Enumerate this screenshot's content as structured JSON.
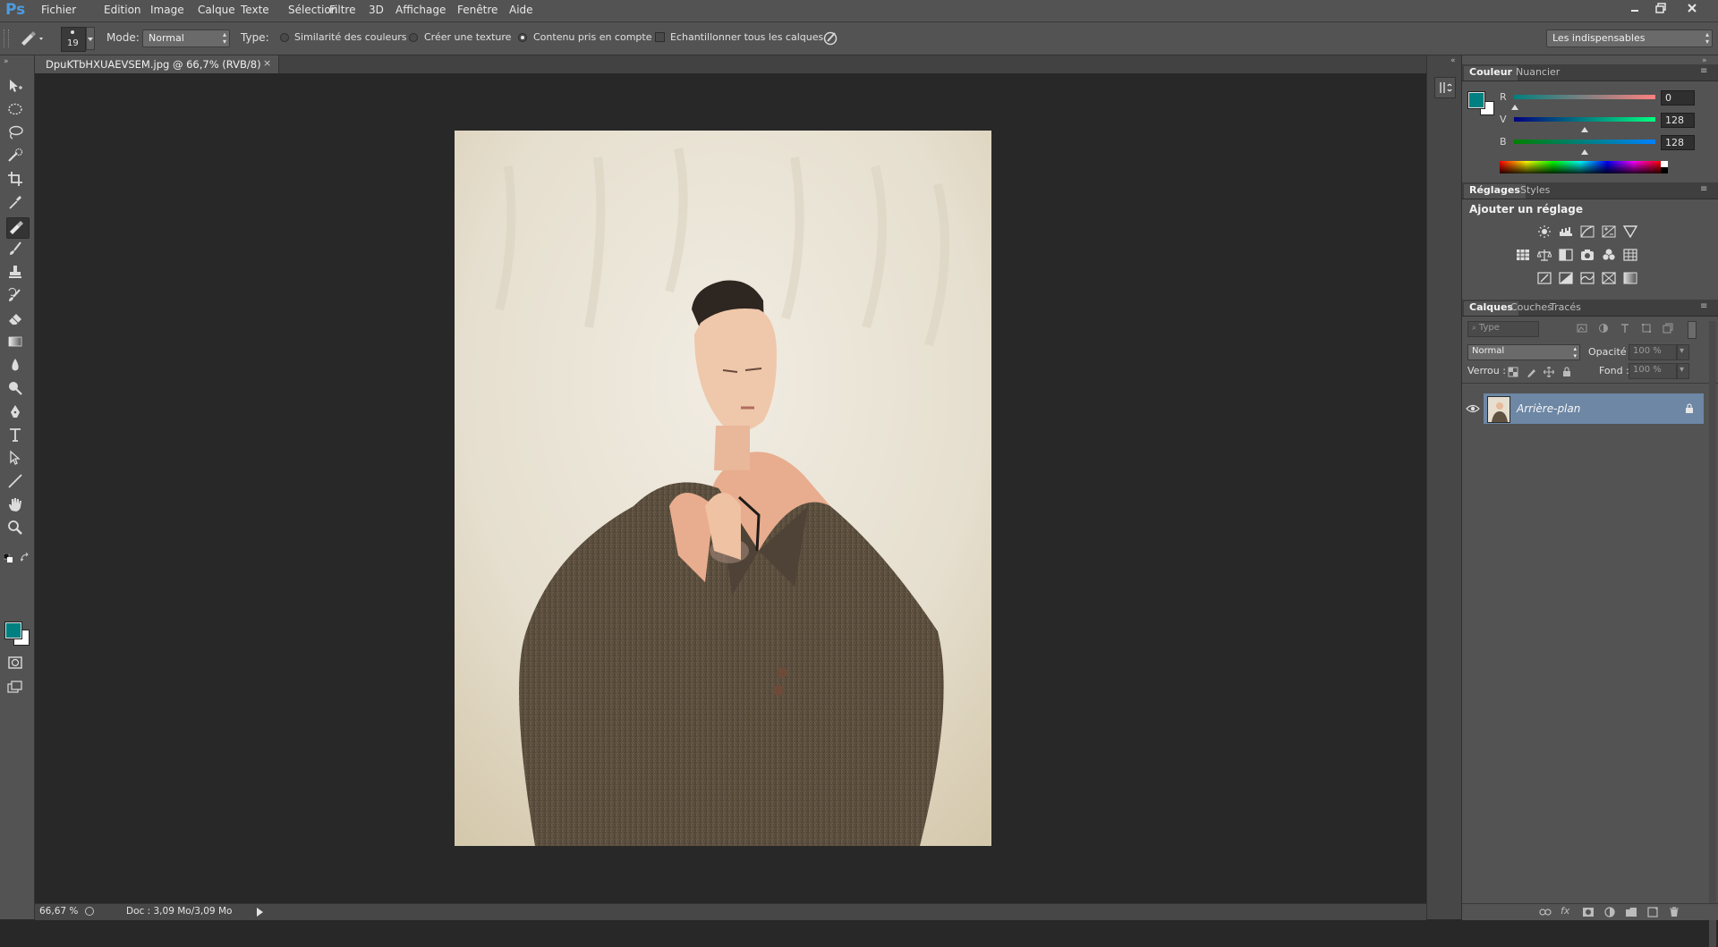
{
  "app": {
    "logo": "Ps"
  },
  "menu": [
    "Fichier",
    "Edition",
    "Image",
    "Calque",
    "Texte",
    "Sélection",
    "Filtre",
    "3D",
    "Affichage",
    "Fenêtre",
    "Aide"
  ],
  "window_controls": [
    "minimize-icon",
    "restore-icon",
    "close-icon"
  ],
  "options": {
    "brush_size": "19",
    "mode_label": "Mode:",
    "mode_value": "Normal",
    "type_label": "Type:",
    "type_options": [
      {
        "label": "Similarité des couleurs",
        "selected": false
      },
      {
        "label": "Créer une texture",
        "selected": false
      },
      {
        "label": "Contenu pris en compte",
        "selected": true
      }
    ],
    "sample_all_label": "Echantillonner tous les calques",
    "sample_all_checked": false,
    "workspace": "Les indispensables"
  },
  "document": {
    "tab_title": "DpuKTbHXUAEVSEM.jpg @ 66,7% (RVB/8)",
    "close": "×",
    "zoom": "66,67 %",
    "doc_info": "Doc : 3,09 Mo/3,09 Mo"
  },
  "tools": [
    "move-tool-icon",
    "marquee-tool-icon",
    "lasso-tool-icon",
    "quick-selection-tool-icon",
    "crop-tool-icon",
    "eyedropper-tool-icon",
    "spot-healing-brush-icon",
    "brush-tool-icon",
    "clone-stamp-icon",
    "history-brush-icon",
    "eraser-tool-icon",
    "gradient-tool-icon",
    "blur-tool-icon",
    "dodge-tool-icon",
    "pen-tool-icon",
    "type-tool-icon",
    "path-selection-icon",
    "line-tool-icon",
    "hand-tool-icon",
    "zoom-tool-icon"
  ],
  "colors": {
    "foreground": "#008080",
    "background": "#ffffff",
    "accent": "#6d87a5"
  },
  "color_panel": {
    "tabs": [
      "Couleur",
      "Nuancier"
    ],
    "channels": [
      {
        "label": "R",
        "value": "0"
      },
      {
        "label": "V",
        "value": "128"
      },
      {
        "label": "B",
        "value": "128"
      }
    ]
  },
  "adjustments_panel": {
    "tabs": [
      "Réglages",
      "Styles"
    ],
    "heading": "Ajouter un réglage",
    "icon_rows": [
      [
        "brightness-contrast-icon",
        "levels-icon",
        "curves-icon",
        "exposure-icon",
        "vibrance-icon"
      ],
      [
        "hue-saturation-icon",
        "color-balance-icon",
        "black-white-icon",
        "photo-filter-icon",
        "channel-mixer-icon",
        "color-lookup-icon"
      ],
      [
        "invert-icon",
        "posterize-icon",
        "threshold-icon",
        "selective-color-icon",
        "gradient-map-icon"
      ]
    ]
  },
  "layers_panel": {
    "tabs": [
      "Calques",
      "Couches",
      "Tracés"
    ],
    "filter_label": "Type",
    "blend_mode": "Normal",
    "opacity_label": "Opacité :",
    "opacity_value": "100 %",
    "lock_label": "Verrou :",
    "fill_label": "Fond :",
    "fill_value": "100 %",
    "layers": [
      {
        "name": "Arrière-plan",
        "visible": true,
        "locked": true
      }
    ],
    "footer_icons": [
      "link-layers-icon",
      "fx-icon",
      "mask-icon",
      "adjustment-layer-icon",
      "group-icon",
      "new-layer-icon",
      "trash-icon"
    ]
  }
}
